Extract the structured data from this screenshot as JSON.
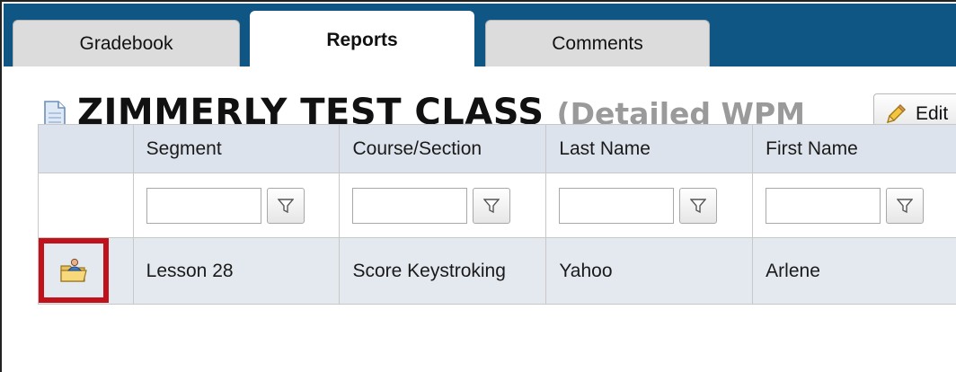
{
  "tabs": [
    {
      "label": "Gradebook",
      "active": false
    },
    {
      "label": "Reports",
      "active": true
    },
    {
      "label": "Comments",
      "active": false
    }
  ],
  "header": {
    "title": "ZIMMERLY TEST CLASS",
    "subtitle": "(Detailed WPM Table)",
    "edit_label": "Edit"
  },
  "table": {
    "columns": [
      "Segment",
      "Course/Section",
      "Last Name",
      "First Name"
    ],
    "rows": [
      {
        "segment": "Lesson 28",
        "course_section": "Score Keystroking",
        "last_name": "Yahoo",
        "first_name": "Arlene"
      }
    ]
  },
  "icons": {
    "title": "document-icon",
    "edit": "pencil-icon",
    "filter": "funnel-icon",
    "row_action": "open-folder-user-icon"
  },
  "colors": {
    "tabbar": "#0f5685",
    "header_row": "#dde3ec",
    "data_row": "#e4e8ef",
    "highlight": "#c0121b",
    "subtitle": "#9a9a9a"
  }
}
